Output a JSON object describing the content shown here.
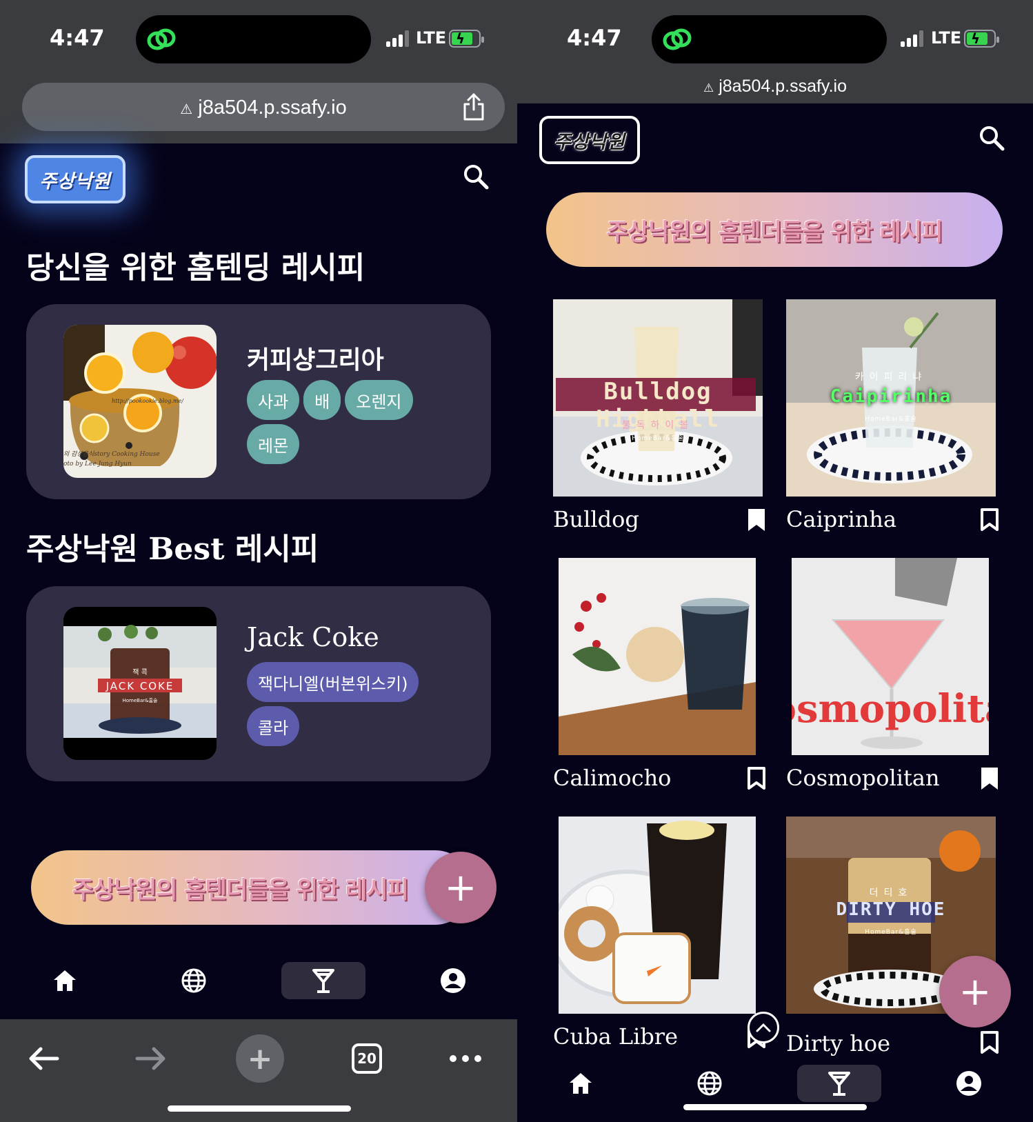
{
  "status_bar": {
    "time": "4:47",
    "network": "LTE"
  },
  "browser": {
    "url": "j8a504.p.ssafy.io",
    "tab_count": "20"
  },
  "app": {
    "logo_text": "주상낙원"
  },
  "home": {
    "section_recommend": "당신을 위한 홈텐딩 레시피",
    "recommend_card": {
      "name": "커피샹그리아",
      "ingredients": [
        "사과",
        "배",
        "오렌지",
        "레몬"
      ],
      "photo_caption": "http://pookookie.blog.me/",
      "photo_credit_1": "의 감성음식story Cooking House",
      "photo_credit_2": "oto by Lee Jung Hyun"
    },
    "section_best": "주상낙원 Best 레시피",
    "best_card": {
      "name": "Jack Coke",
      "ingredients": [
        "잭다니엘(버본위스키)",
        "콜라"
      ],
      "photo_title": "JACK COKE",
      "photo_subtitle": "잭 콕",
      "photo_brand": "HomeBar&홈술"
    },
    "banner_text": "주상낙원의 홈텐더들을 위한 레시피",
    "fab_label": "+"
  },
  "list": {
    "banner_text": "주상낙원의 홈텐더들을 위한 레시피",
    "fab_label": "+",
    "items": [
      {
        "name": "Bulldog",
        "overlay": "Bulldog Highball",
        "overlay_sub": "불독하이볼",
        "overlay_brand": "HomeBar&홈술",
        "bookmarked": true
      },
      {
        "name": "Caiprinha",
        "overlay": "Caipirinha",
        "overlay_sub": "카이피리냐",
        "overlay_brand": "HomeBar&홈술",
        "bookmarked": false
      },
      {
        "name": "Calimocho",
        "overlay": "",
        "bookmarked": false
      },
      {
        "name": "Cosmopolitan",
        "overlay": "osmopolita",
        "bookmarked": true
      },
      {
        "name": "Cuba Libre",
        "overlay": "",
        "bookmarked": false
      },
      {
        "name": "Dirty hoe",
        "overlay": "DIRTY HOE",
        "overlay_sub": "더티호",
        "overlay_brand": "HomeBar&홈술",
        "bookmarked": false
      }
    ]
  },
  "bottom_nav": [
    {
      "icon": "home-icon",
      "active": false
    },
    {
      "icon": "globe-icon",
      "active": false
    },
    {
      "icon": "cocktail-icon",
      "active": true
    },
    {
      "icon": "profile-icon",
      "active": false
    }
  ],
  "colors": {
    "background": "#05031a",
    "card": "#312d44",
    "chip_teal": "#68aaa6",
    "chip_purple": "#5d5cac",
    "fab": "#b56e8e",
    "banner_gradient": [
      "#f2c48a",
      "#e5b8c3",
      "#c7b0ef"
    ],
    "browser_chrome": "#3a3c40"
  }
}
